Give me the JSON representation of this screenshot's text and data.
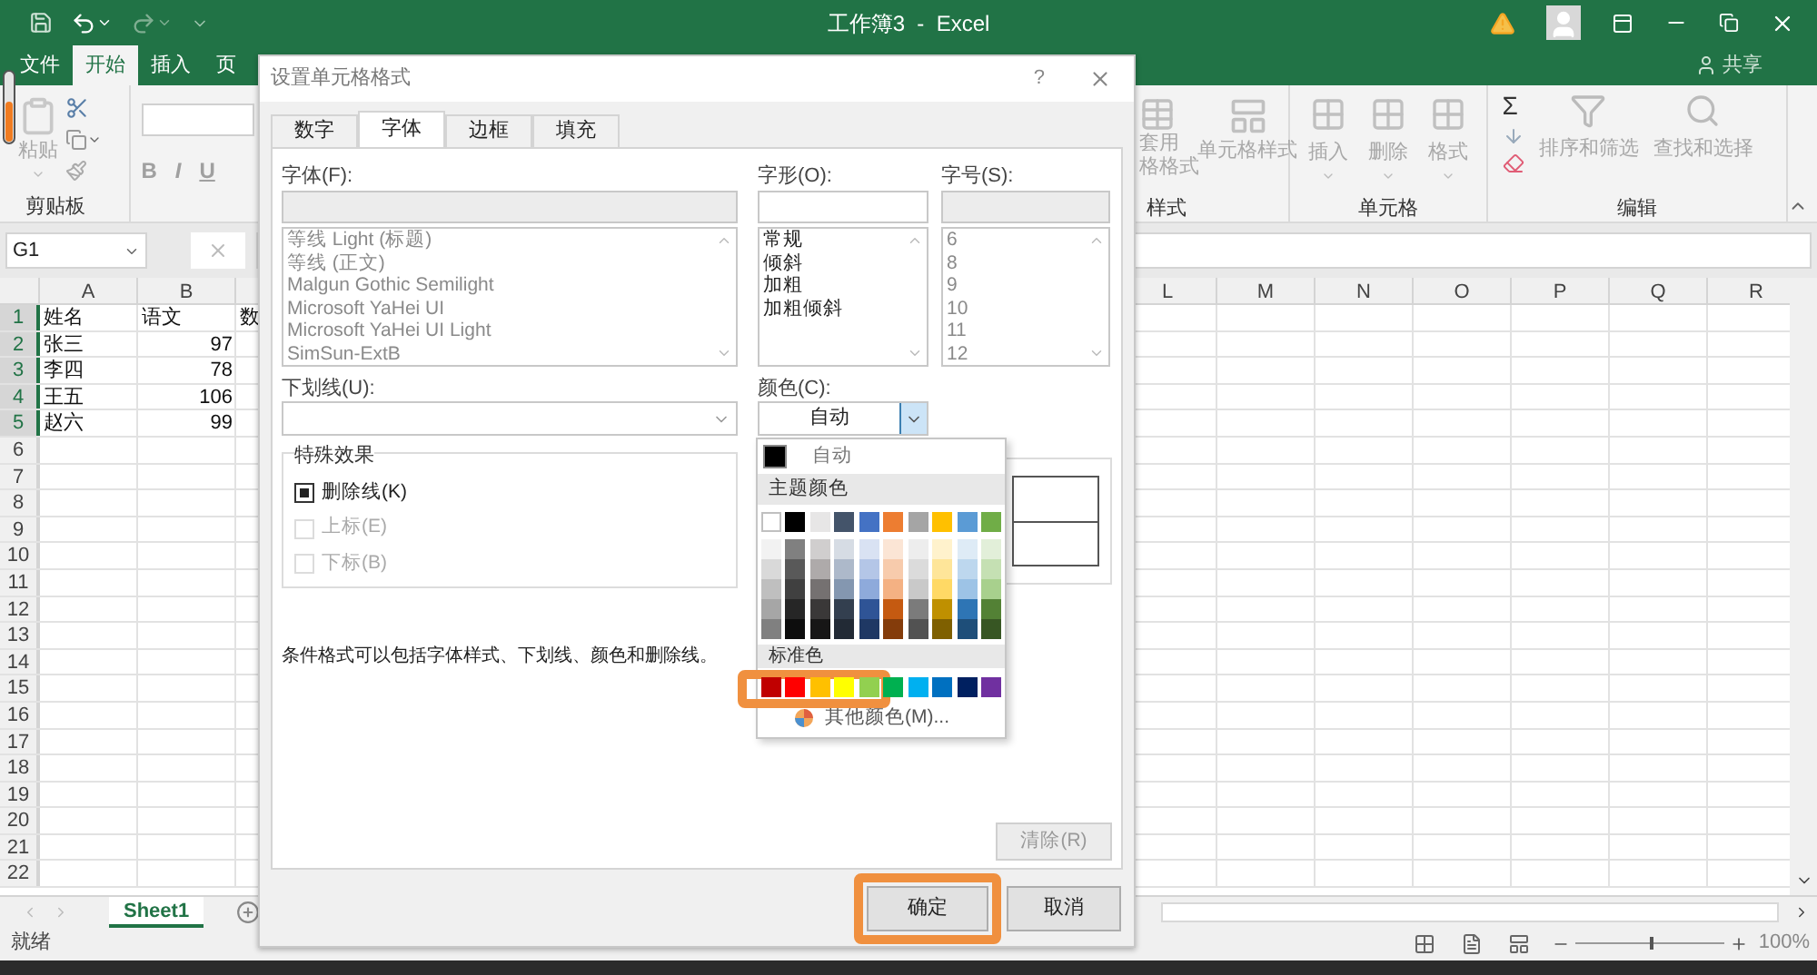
{
  "title_bar": {
    "title": "工作簿3  -  Excel"
  },
  "ribbon_tabs": [
    {
      "label": "文件",
      "selected": false
    },
    {
      "label": "开始",
      "selected": true
    },
    {
      "label": "插入",
      "selected": false
    },
    {
      "label": "页",
      "selected": false
    }
  ],
  "share": "共享",
  "ribbon": {
    "clipboard": {
      "paste": "粘贴",
      "group": "剪贴板"
    },
    "font": {
      "bold": "B",
      "italic": "I",
      "underline": "U"
    },
    "styles": {
      "table_format": [
        "套用",
        "格格式"
      ],
      "cell_styles": "单元格样式",
      "group": "样式"
    },
    "cells": {
      "buttons": [
        "插入",
        "删除",
        "格式"
      ],
      "group": "单元格"
    },
    "editing": {
      "sigma": "Σ",
      "sort": "排序和筛选",
      "find": "查找和选择",
      "group": "编辑"
    }
  },
  "formula_bar": {
    "name_box": "G1"
  },
  "sheet": {
    "columns_left": [
      "A",
      "B"
    ],
    "columns_right": [
      "L",
      "M",
      "N",
      "O",
      "P",
      "Q",
      "R"
    ],
    "rows": [
      {
        "number": "1",
        "selected": true,
        "cells": [
          {
            "text": "姓名",
            "kind": "text"
          },
          {
            "text": "语文",
            "kind": "text"
          },
          {
            "text": "数",
            "kind": "text"
          }
        ]
      },
      {
        "number": "2",
        "selected": true,
        "cells": [
          {
            "text": "张三",
            "kind": "text"
          },
          {
            "text": "97",
            "kind": "number"
          }
        ]
      },
      {
        "number": "3",
        "selected": true,
        "cells": [
          {
            "text": "李四",
            "kind": "text"
          },
          {
            "text": "78",
            "kind": "number"
          }
        ]
      },
      {
        "number": "4",
        "selected": true,
        "cells": [
          {
            "text": "王五",
            "kind": "text"
          },
          {
            "text": "106",
            "kind": "number"
          }
        ]
      },
      {
        "number": "5",
        "selected": true,
        "cells": [
          {
            "text": "赵六",
            "kind": "text"
          },
          {
            "text": "99",
            "kind": "number"
          }
        ]
      },
      {
        "number": "6",
        "selected": false,
        "cells": []
      },
      {
        "number": "7",
        "selected": false,
        "cells": []
      },
      {
        "number": "8",
        "selected": false,
        "cells": []
      },
      {
        "number": "9",
        "selected": false,
        "cells": []
      },
      {
        "number": "10",
        "selected": false,
        "cells": []
      },
      {
        "number": "11",
        "selected": false,
        "cells": []
      },
      {
        "number": "12",
        "selected": false,
        "cells": []
      },
      {
        "number": "13",
        "selected": false,
        "cells": []
      },
      {
        "number": "14",
        "selected": false,
        "cells": []
      },
      {
        "number": "15",
        "selected": false,
        "cells": []
      },
      {
        "number": "16",
        "selected": false,
        "cells": []
      },
      {
        "number": "17",
        "selected": false,
        "cells": []
      },
      {
        "number": "18",
        "selected": false,
        "cells": []
      },
      {
        "number": "19",
        "selected": false,
        "cells": []
      },
      {
        "number": "20",
        "selected": false,
        "cells": []
      },
      {
        "number": "21",
        "selected": false,
        "cells": []
      },
      {
        "number": "22",
        "selected": false,
        "cells": []
      }
    ]
  },
  "sheet_tabs": [
    {
      "label": "Sheet1",
      "selected": true
    }
  ],
  "status_bar": {
    "status": "就绪",
    "zoom": {
      "level": 0.5,
      "reading": "100%"
    }
  },
  "dialog": {
    "title": "设置单元格格式",
    "help": "?",
    "tabs": [
      {
        "label": "数字",
        "selected": false
      },
      {
        "label": "字体",
        "selected": true
      },
      {
        "label": "边框",
        "selected": false
      },
      {
        "label": "填充",
        "selected": false
      }
    ],
    "font": {
      "label": "字体(F):",
      "disabled": true,
      "items": [
        "等线 Light (标题)",
        "等线 (正文)",
        "Malgun Gothic Semilight",
        "Microsoft YaHei UI",
        "Microsoft YaHei UI Light",
        "SimSun-ExtB"
      ]
    },
    "style": {
      "label": "字形(O):",
      "disabled": false,
      "items": [
        "常规",
        "倾斜",
        "加粗",
        "加粗倾斜"
      ]
    },
    "size": {
      "label": "字号(S):",
      "disabled": true,
      "items": [
        "6",
        "8",
        "9",
        "10",
        "11",
        "12"
      ]
    },
    "underline": {
      "label": "下划线(U):"
    },
    "color": {
      "label": "颜色(C):",
      "value": "自动",
      "expanded": true
    },
    "effects": {
      "title": "特殊效果",
      "items": [
        {
          "label": "删除线(K)",
          "checked": true,
          "disabled": false
        },
        {
          "label": "上标(E)",
          "checked": false,
          "disabled": true
        },
        {
          "label": "下标(B)",
          "checked": false,
          "disabled": true
        }
      ]
    },
    "note": "条件格式可以包括字体样式、下划线、颜色和删除线。",
    "clear_button": {
      "label": "清除(R)",
      "disabled": true
    },
    "buttons": [
      {
        "label": "确定",
        "highlighted": true
      },
      {
        "label": "取消",
        "highlighted": false
      }
    ]
  },
  "color_picker": {
    "automatic": "自动",
    "theme_title": "主题颜色",
    "theme_columns": [
      {
        "swatches": [
          {
            "color": "#ffffff"
          },
          {
            "color": "#f2f2f2"
          },
          {
            "color": "#d9d9d9"
          },
          {
            "color": "#bfbfbf"
          },
          {
            "color": "#a6a6a6"
          },
          {
            "color": "#808080"
          }
        ]
      },
      {
        "swatches": [
          {
            "color": "#000000"
          },
          {
            "color": "#808080"
          },
          {
            "color": "#595959"
          },
          {
            "color": "#404040"
          },
          {
            "color": "#262626"
          },
          {
            "color": "#0d0d0d"
          }
        ]
      },
      {
        "swatches": [
          {
            "color": "#e7e6e6"
          },
          {
            "color": "#d0cece"
          },
          {
            "color": "#aeaaaa"
          },
          {
            "color": "#757171"
          },
          {
            "color": "#3a3838"
          },
          {
            "color": "#171616"
          }
        ]
      },
      {
        "swatches": [
          {
            "color": "#44546a"
          },
          {
            "color": "#d6dce4"
          },
          {
            "color": "#adb9ca"
          },
          {
            "color": "#8497b0"
          },
          {
            "color": "#333f4f"
          },
          {
            "color": "#222a35"
          }
        ]
      },
      {
        "swatches": [
          {
            "color": "#4472c4"
          },
          {
            "color": "#d9e2f3"
          },
          {
            "color": "#b4c6e7"
          },
          {
            "color": "#8eaadb"
          },
          {
            "color": "#2f5496"
          },
          {
            "color": "#1f3864"
          }
        ]
      },
      {
        "swatches": [
          {
            "color": "#ed7d31"
          },
          {
            "color": "#fbe5d5"
          },
          {
            "color": "#f7cbac"
          },
          {
            "color": "#f4b183"
          },
          {
            "color": "#c55a11"
          },
          {
            "color": "#843c0b"
          }
        ]
      },
      {
        "swatches": [
          {
            "color": "#a5a5a5"
          },
          {
            "color": "#ededed"
          },
          {
            "color": "#dbdbdb"
          },
          {
            "color": "#c9c9c9"
          },
          {
            "color": "#7b7b7b"
          },
          {
            "color": "#525252"
          }
        ]
      },
      {
        "swatches": [
          {
            "color": "#ffc000"
          },
          {
            "color": "#fff2cc"
          },
          {
            "color": "#fee599"
          },
          {
            "color": "#ffd965"
          },
          {
            "color": "#bf9000"
          },
          {
            "color": "#7f6000"
          }
        ]
      },
      {
        "swatches": [
          {
            "color": "#5b9bd5"
          },
          {
            "color": "#deebf6"
          },
          {
            "color": "#bdd7ee"
          },
          {
            "color": "#9dc3e6"
          },
          {
            "color": "#2e75b5"
          },
          {
            "color": "#1e4e79"
          }
        ]
      },
      {
        "swatches": [
          {
            "color": "#70ad47"
          },
          {
            "color": "#e2efd9"
          },
          {
            "color": "#c5e0b3"
          },
          {
            "color": "#a8d08d"
          },
          {
            "color": "#538135"
          },
          {
            "color": "#375623"
          }
        ]
      }
    ],
    "standard_title": "标准色",
    "standard_colors": [
      {
        "color": "#c00000"
      },
      {
        "color": "#ff0000"
      },
      {
        "color": "#ffc000"
      },
      {
        "color": "#ffff00"
      },
      {
        "color": "#92d050"
      },
      {
        "color": "#00b050"
      },
      {
        "color": "#00b0f0"
      },
      {
        "color": "#0070c0"
      },
      {
        "color": "#002060"
      },
      {
        "color": "#7030a0"
      }
    ],
    "standard_highlighted": true,
    "more_colors": "其他颜色(M)..."
  }
}
